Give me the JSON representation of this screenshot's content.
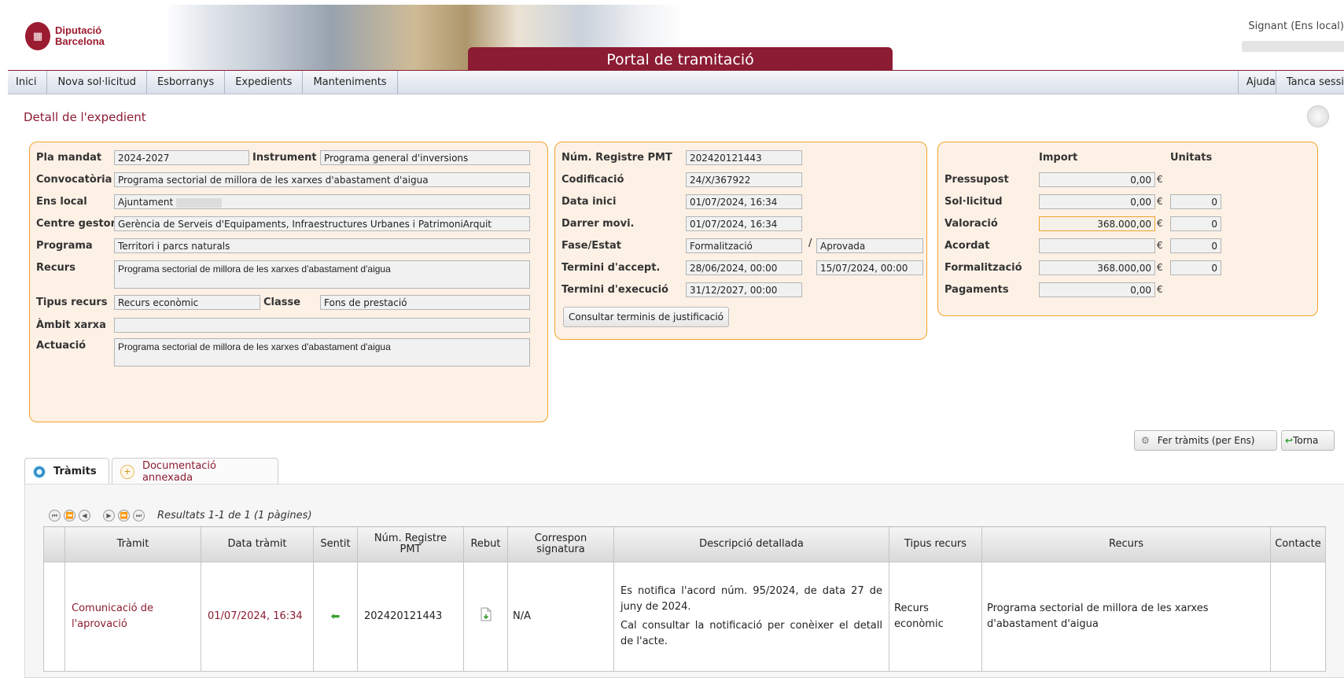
{
  "header": {
    "logo_line1": "Diputació",
    "logo_line2": "Barcelona",
    "portal_title": "Portal de tramitació",
    "signant": "Signant (Ens local)"
  },
  "menu": {
    "left": [
      "Inici",
      "Nova sol·licitud",
      "Esborranys",
      "Expedients",
      "Manteniments"
    ],
    "right": [
      "Ajuda",
      "Tanca sessi"
    ]
  },
  "page_title": "Detall de l'expedient",
  "panel1": {
    "pla_mandat_label": "Pla mandat",
    "pla_mandat": "2024-2027",
    "instrument_label": "Instrument",
    "instrument": "Programa general d'inversions",
    "convocatoria_label": "Convocatòria",
    "convocatoria": "Programa sectorial de millora de les xarxes d'abastament d'aigua",
    "ens_local_label": "Ens local",
    "ens_local": "Ajuntament",
    "centre_gestor_label": "Centre gestor",
    "centre_gestor": "Gerència de Serveis d'Equipaments, Infraestructures Urbanes i PatrimoniArquit",
    "programa_label": "Programa",
    "programa": "Territori i parcs naturals",
    "recurs_label": "Recurs",
    "recurs": "Programa sectorial de millora de les xarxes d'abastament d'aigua",
    "tipus_recurs_label": "Tipus recurs",
    "tipus_recurs": "Recurs econòmic",
    "classe_label": "Classe",
    "classe": "Fons de prestació",
    "ambit_xarxa_label": "Àmbit xarxa",
    "ambit_xarxa": "",
    "actuacio_label": "Actuació",
    "actuacio": "Programa sectorial de millora de les xarxes d'abastament d'aigua"
  },
  "panel2": {
    "num_registre_label": "Núm. Registre PMT",
    "num_registre": "202420121443",
    "codificacio_label": "Codificació",
    "codificacio": "24/X/367922",
    "data_inici_label": "Data inici",
    "data_inici": "01/07/2024, 16:34",
    "darrer_movi_label": "Darrer movi.",
    "darrer_movi": "01/07/2024, 16:34",
    "fase_estat_label": "Fase/Estat",
    "fase": "Formalització",
    "estat": "Aprovada",
    "slash": "/",
    "termini_accept_label": "Termini d'accept.",
    "termini_accept_1": "28/06/2024, 00:00",
    "termini_accept_2": "15/07/2024, 00:00",
    "termini_execucio_label": "Termini d'execució",
    "termini_execucio": "31/12/2027, 00:00",
    "consultar_button": "Consultar terminis de justificació"
  },
  "panel3": {
    "import_header": "Import",
    "unitats_header": "Unitats",
    "currency": "€",
    "rows": [
      {
        "label": "Pressupost",
        "import": "0,00",
        "unitats": null
      },
      {
        "label": "Sol·licitud",
        "import": "0,00",
        "unitats": "0"
      },
      {
        "label": "Valoració",
        "import": "368.000,00",
        "unitats": "0"
      },
      {
        "label": "Acordat",
        "import": "",
        "unitats": "0"
      },
      {
        "label": "Formalització",
        "import": "368.000,00",
        "unitats": "0"
      },
      {
        "label": "Pagaments",
        "import": "0,00",
        "unitats": null
      }
    ]
  },
  "actions": {
    "fer_tramits": "Fer tràmits (per Ens)",
    "torna": "Torna"
  },
  "tabs": {
    "tramits": "Tràmits",
    "documentacio": "Documentació annexada"
  },
  "pager": {
    "results": "Resultats 1-1 de 1 (1 pàgines)"
  },
  "table": {
    "headers": {
      "tramit": "Tràmit",
      "data_tramit": "Data tràmit",
      "sentit": "Sentit",
      "num_registre_line1": "Núm. Registre",
      "num_registre_line2": "PMT",
      "rebut": "Rebut",
      "correspon_line1": "Correspon",
      "correspon_line2": "signatura",
      "descripcio": "Descripció detallada",
      "tipus_recurs": "Tipus recurs",
      "recurs": "Recurs",
      "contacte": "Contacte"
    },
    "row": {
      "tramit": "Comunicació de l'aprovació",
      "data_tramit": "01/07/2024, 16:34",
      "num_registre": "202420121443",
      "correspon": "N/A",
      "descripcio_p1": "Es notifica l'acord núm. 95/2024, de data 27 de juny de 2024.",
      "descripcio_p2": "Cal consultar la notificació per conèixer el detall de l'acte.",
      "tipus_recurs": "Recurs econòmic",
      "recurs": "Programa sectorial de millora de les xarxes d'abastament d'aigua",
      "contacte": ""
    }
  }
}
